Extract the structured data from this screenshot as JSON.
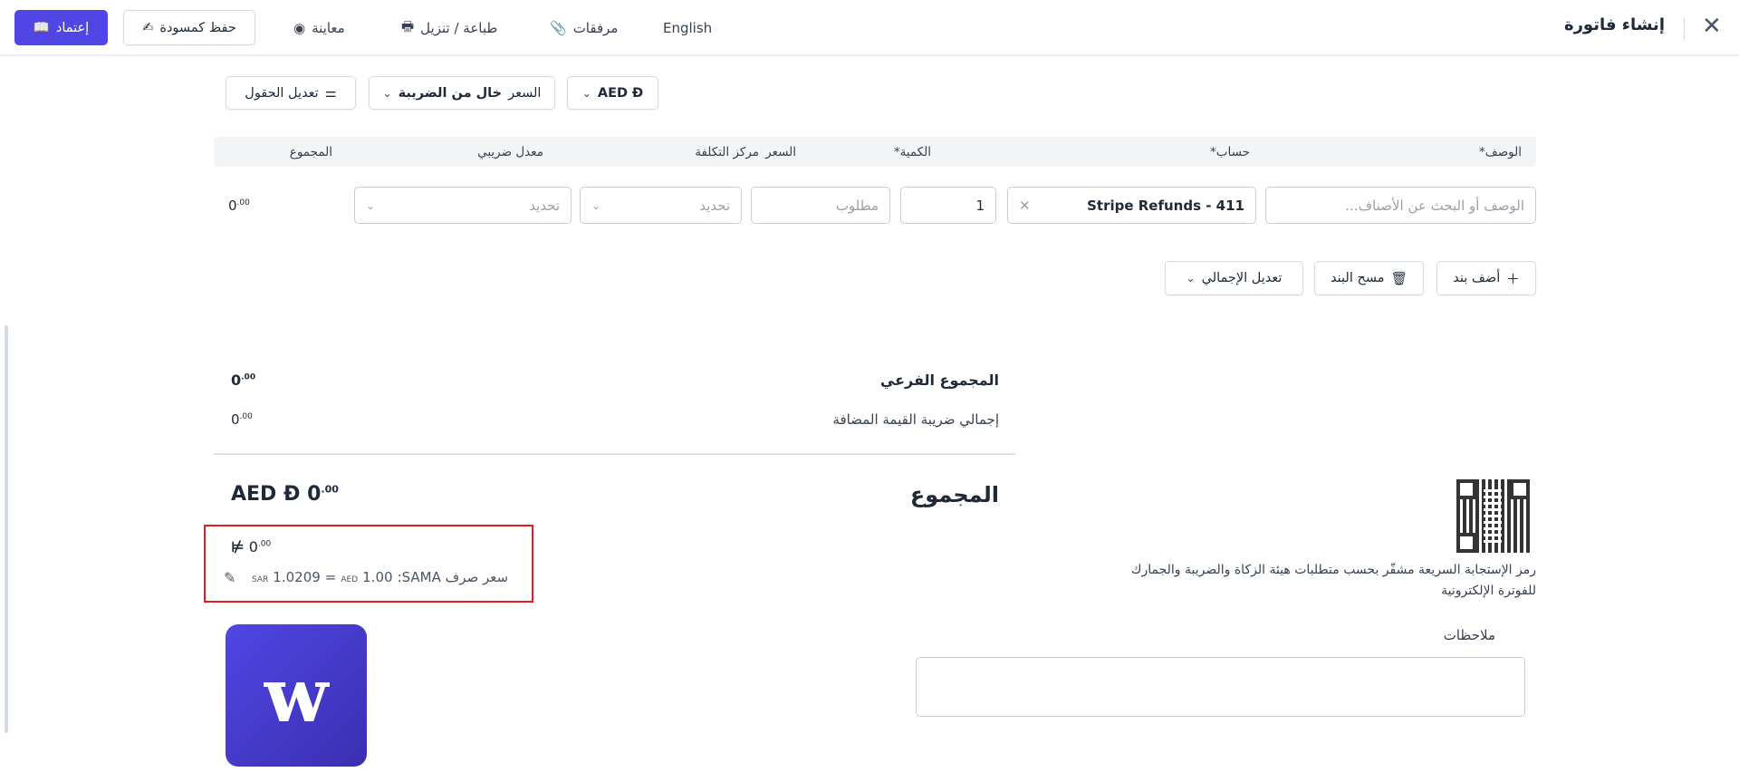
{
  "header": {
    "title": "إنشاء فاتورة",
    "approve": "إعتماد",
    "save_draft": "حفظ كمسودة",
    "preview": "معاينة",
    "print": "طباعة / تنزيل",
    "attachments": "مرفقات",
    "language": "English"
  },
  "toolbar": {
    "edit_fields": "تعديل الحقول",
    "price_label": "السعر",
    "price_mode": "خال من الضريبة",
    "currency": "AED Ð"
  },
  "table": {
    "headers": {
      "description": "الوصف*",
      "account": "حساب*",
      "quantity": "الكمية*",
      "price": "السعر",
      "cost_center": "مركز التكلفة",
      "tax_rate": "معدل ضريبي",
      "total": "المجموع"
    },
    "row": {
      "description_placeholder": "الوصف أو البحث عن الأصناف...",
      "account": "Stripe Refunds - 411",
      "quantity": "1",
      "price_placeholder": "مطلوب",
      "cost_center_placeholder": "تحديد",
      "tax_placeholder": "تحديد",
      "total_int": "0",
      "total_dec": ".00"
    }
  },
  "actions": {
    "add_line": "أضف بند",
    "clear_line": "مسح البند",
    "adjust_total": "تعديل الإجمالي"
  },
  "summary": {
    "subtotal_label": "المجموع الفرعي",
    "subtotal_int": "0",
    "subtotal_dec": ".00",
    "vat_label": "إجمالي ضريبة القيمة المضافة",
    "vat_int": "0",
    "vat_dec": ".00",
    "total_label": "المجموع",
    "total_currency": "AED Ð",
    "total_int": "0",
    "total_dec": ".00"
  },
  "conversion": {
    "sar_symbol": "⃁",
    "sar_int": "0",
    "sar_dec": ".00",
    "rate_label": "سعر صرف SAMA:",
    "from_amount": "1.00",
    "from_cur": "AED",
    "eq": "=",
    "to_amount": "1.0209",
    "to_cur": "SAR"
  },
  "qr": {
    "caption_line1": "رمز الإستجابة السريعة مشفّر بحسب متطلبات هيئة الزكاة والضريبة والجمارك",
    "caption_line2": "للفوترة الإلكترونية"
  },
  "notes": {
    "label": "ملاحظات",
    "value": ""
  },
  "colors": {
    "accent": "#4f46e5",
    "highlight": "#e11d1d"
  }
}
